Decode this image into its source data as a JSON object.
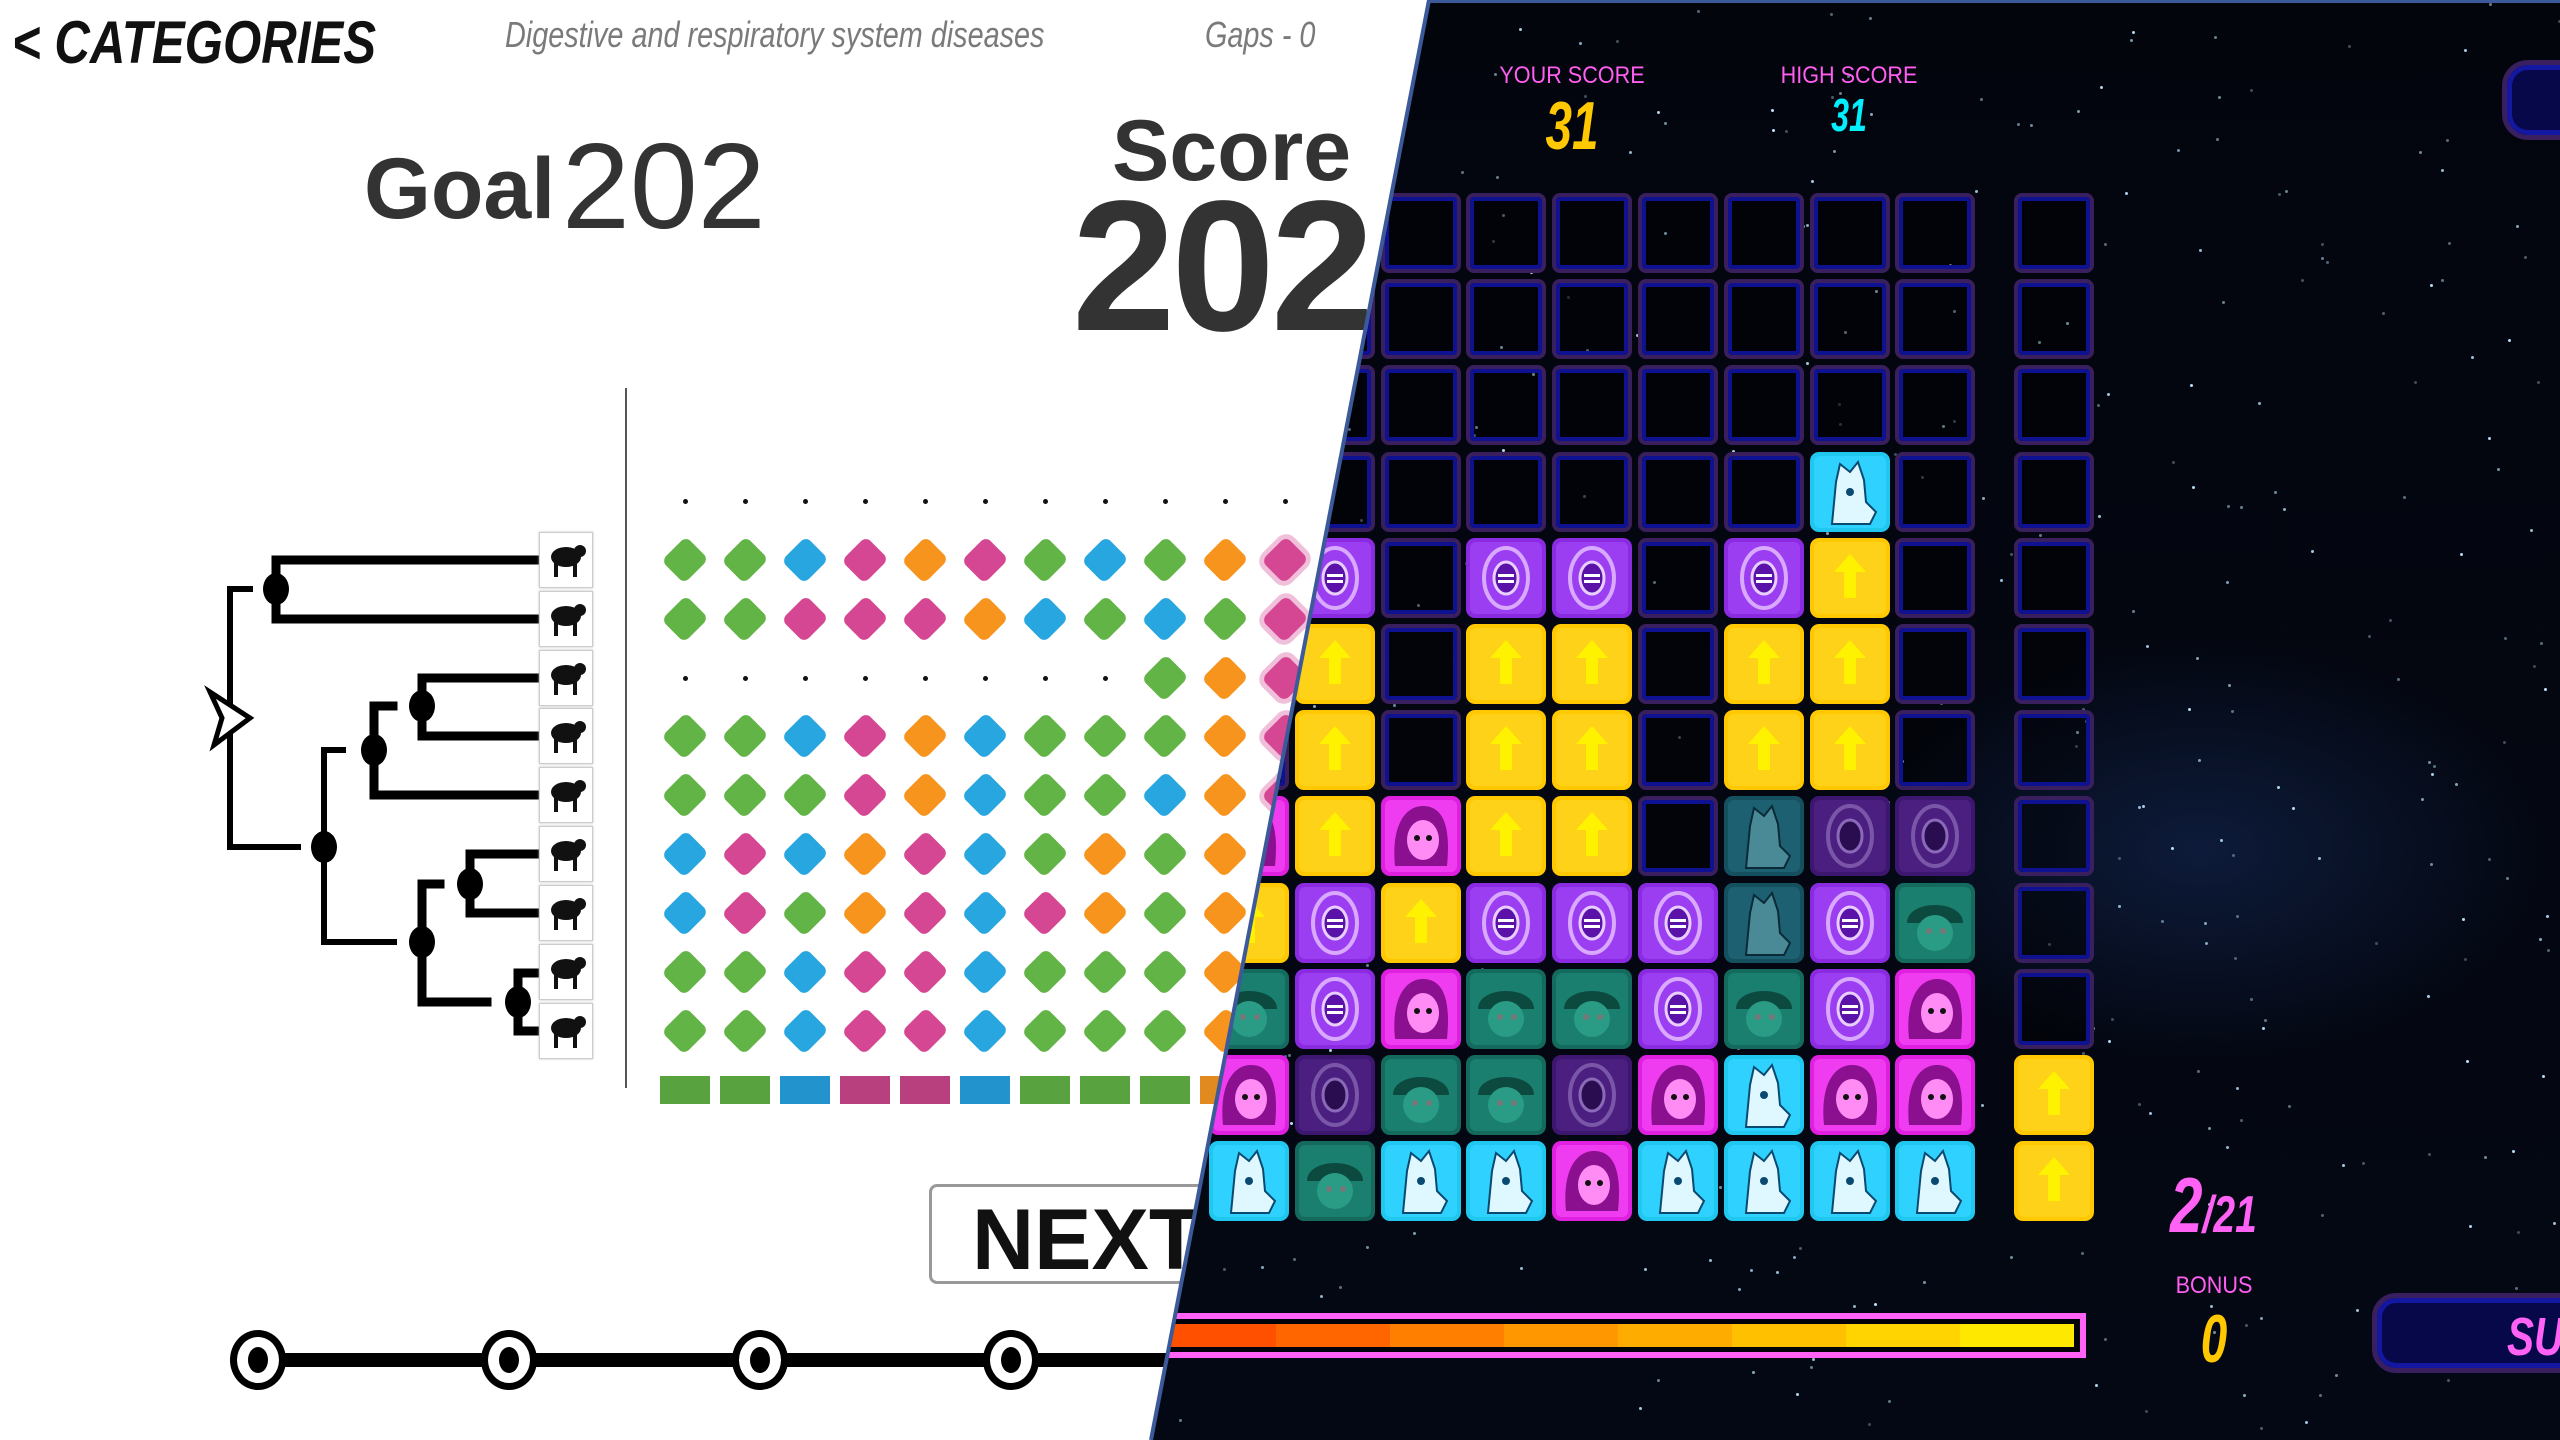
{
  "left_game": {
    "back_label": "< CATEGORIES",
    "category": "Digestive and respiratory system diseases",
    "gaps": "Gaps - 0",
    "goal_label": "Goal",
    "goal_value": "202",
    "score_label": "Score",
    "score_value": "202",
    "next_label": "NEXT",
    "colors": {
      "G": "#62b446",
      "B": "#27a6e0",
      "P": "#d54793",
      "O": "#f7941e"
    },
    "bar_colors": {
      "G": "#58a23f",
      "B": "#2293cc",
      "P": "#b8407f",
      "O": "#e08a20"
    },
    "species": [
      "anteater-icon",
      "elephant-icon",
      "dog-icon",
      "horse-icon",
      "cow-icon",
      "rat-icon",
      "mouse-icon",
      "monkey-icon",
      "human-icon"
    ],
    "dots_row": 11,
    "matrix": [
      "GGBPOPGBGOP",
      "GGPPPOBGBGP",
      "........GOP",
      "GGBPOBGGGOP",
      "GGGPOBGGBOP",
      "BPBOPBGOGO",
      "BPGOPBPOGO",
      "GGBPPBGGGO",
      "GGBPPBGGGO"
    ],
    "bars": "GGBPPBGGGO",
    "timeline_steps": 4
  },
  "right_game": {
    "your_score_label": "YOUR SCORE",
    "your_score_value": "31",
    "high_score_label": "HIGH SCORE",
    "high_score_value": "31",
    "moves_used": "2",
    "moves_total": "/21",
    "bonus_label": "BONUS",
    "bonus_value": "0",
    "submit_label": "SUB",
    "timer_fill": 1.0,
    "accent": {
      "pink": "#ff62f4",
      "yellow": "#ffc800",
      "cyan": "#00f0ff"
    },
    "board": [
      ".........",
      ".........",
      ".........",
      ".......I.",
      ".E.EE.EY.",
      ".Y.YY.YY.",
      ".Y.YY.YY.",
      "PYPYY.iee",
      "YEYEEEiEG",
      "GEPGGEGEP",
      "PeGGePIPP",
      "IGIIPIIII"
    ],
    "side_column": "..........YY"
  }
}
